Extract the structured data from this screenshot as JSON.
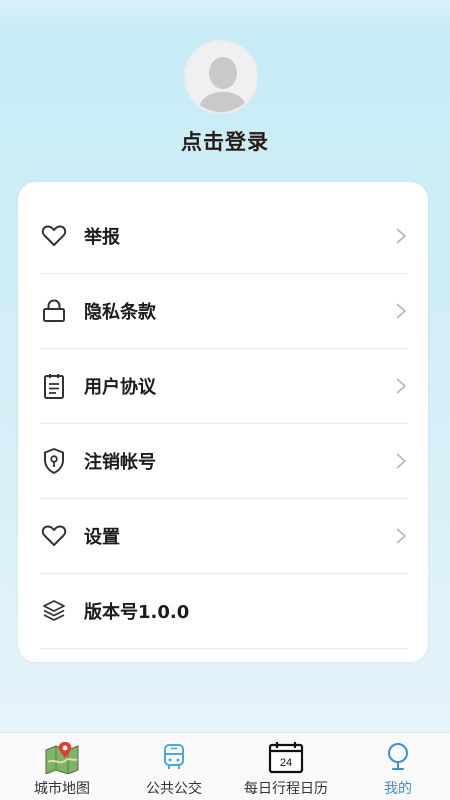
{
  "profile": {
    "login_text": "点击登录"
  },
  "menu": {
    "items": [
      {
        "label": "举报",
        "icon": "heart-icon",
        "has_arrow": true
      },
      {
        "label": "隐私条款",
        "icon": "lock-icon",
        "has_arrow": true
      },
      {
        "label": "用户协议",
        "icon": "document-icon",
        "has_arrow": true
      },
      {
        "label": "注销帐号",
        "icon": "shield-icon",
        "has_arrow": true
      },
      {
        "label": "设置",
        "icon": "heart-icon",
        "has_arrow": true
      },
      {
        "label": "版本号1.0.0",
        "icon": "layers-icon",
        "has_arrow": false
      }
    ]
  },
  "tabbar": {
    "tabs": [
      {
        "label": "城市地图",
        "icon": "map-icon"
      },
      {
        "label": "公共公交",
        "icon": "bus-icon"
      },
      {
        "label": "每日行程日历",
        "icon": "calendar-icon",
        "calendar_day": "24"
      },
      {
        "label": "我的",
        "icon": "user-icon",
        "active": true
      }
    ]
  },
  "colors": {
    "accent": "#3a8fd8",
    "bus_icon": "#4aa9d8",
    "bg_top": "#c6ecf6"
  }
}
